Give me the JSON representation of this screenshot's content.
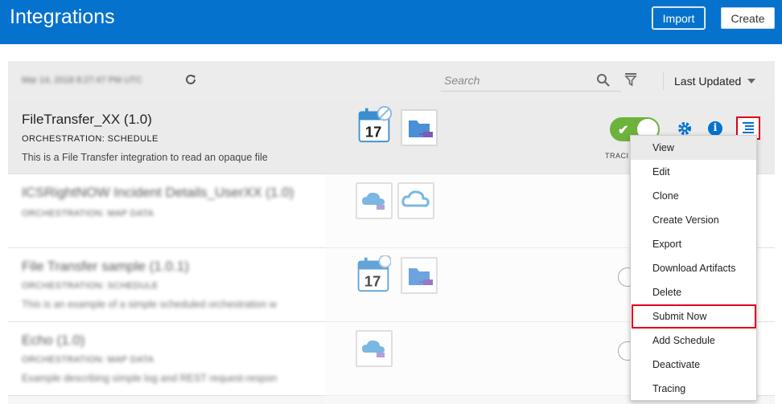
{
  "header": {
    "title": "Integrations",
    "import_label": "Import",
    "create_label": "Create"
  },
  "toolbar": {
    "timestamp": "Mar 14, 2018 8:27:47 PM UTC",
    "search_placeholder": "Search",
    "sort_label": "Last Updated"
  },
  "rows": [
    {
      "name": "FileTransfer_XX  (1.0)",
      "pattern": "ORCHESTRATION: SCHEDULE",
      "description": "This is a File Transfer integration to read an opaque file",
      "tracing_label": "TRACI",
      "active": true
    },
    {
      "name": "ICSRightNOW Incident Details_UserXX  (1.0)",
      "pattern": "ORCHESTRATION: MAP DATA",
      "description": ""
    },
    {
      "name": "File Transfer sample  (1.0.1)",
      "pattern": "ORCHESTRATION: SCHEDULE",
      "description": "This is an example of a simple scheduled orchestration w"
    },
    {
      "name": "Echo  (1.0)",
      "pattern": "ORCHESTRATION: MAP DATA",
      "description": "Example describing simple log and REST request-respon"
    }
  ],
  "calendar_day": "17",
  "menu": {
    "items": [
      "View",
      "Edit",
      "Clone",
      "Create Version",
      "Export",
      "Download Artifacts",
      "Delete",
      "Submit Now",
      "Add Schedule",
      "Deactivate",
      "Tracing"
    ]
  },
  "colors": {
    "brand": "#0572ce",
    "active": "#6cb23c",
    "highlight": "#e0001a"
  },
  "icons": [
    "refresh-icon",
    "search-icon",
    "filter-icon",
    "caret-down-icon",
    "calendar-icon",
    "ftp-adapter-icon",
    "cloud-adapter-icon",
    "gear-icon",
    "info-icon",
    "menu-icon"
  ]
}
